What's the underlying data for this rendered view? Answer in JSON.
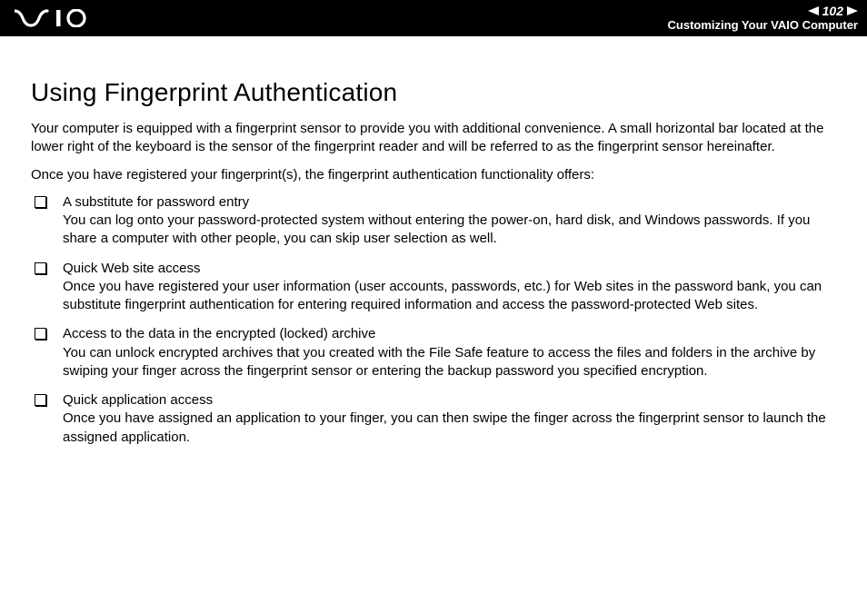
{
  "header": {
    "page_number": "102",
    "breadcrumb": "Customizing Your VAIO Computer"
  },
  "content": {
    "title": "Using Fingerprint Authentication",
    "intro1": "Your computer is equipped with a fingerprint sensor to provide you with additional convenience. A small horizontal bar located at the lower right of the keyboard is the sensor of the fingerprint reader and will be referred to as the fingerprint sensor hereinafter.",
    "intro2": "Once you have registered your fingerprint(s), the fingerprint authentication functionality offers:",
    "items": [
      {
        "title": "A substitute for password entry",
        "desc": "You can log onto your password-protected system without entering the power-on, hard disk, and Windows passwords. If you share a computer with other people, you can skip user selection as well."
      },
      {
        "title": "Quick Web site access",
        "desc": "Once you have registered your user information (user accounts, passwords, etc.) for Web sites in the password bank, you can substitute fingerprint authentication for entering required information and access the password-protected Web sites."
      },
      {
        "title": "Access to the data in the encrypted (locked) archive",
        "desc": "You can unlock encrypted archives that you created with the File Safe feature to access the files and folders in the archive by swiping your finger across the fingerprint sensor or entering the backup password you specified encryption."
      },
      {
        "title": "Quick application access",
        "desc": "Once you have assigned an application to your finger, you can then swipe the finger across the fingerprint sensor to launch the assigned application."
      }
    ]
  }
}
